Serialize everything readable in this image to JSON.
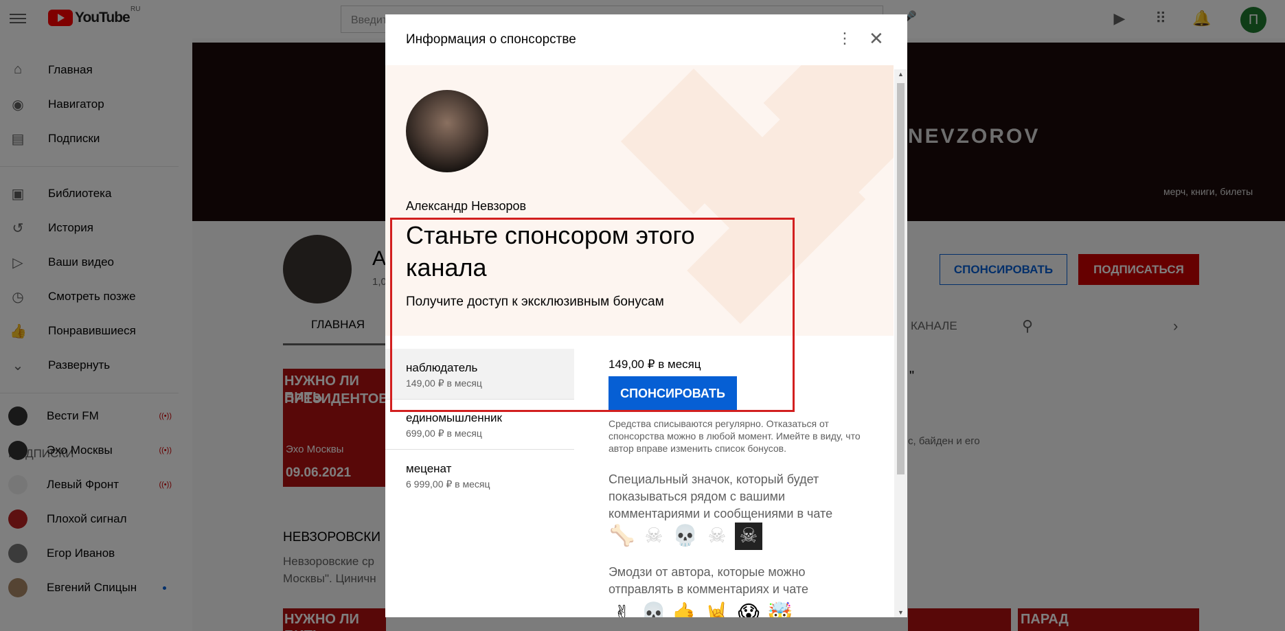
{
  "topbar": {
    "logo_text": "YouTube",
    "region": "RU",
    "search_placeholder": "Введите запрос",
    "avatar_letter": "П"
  },
  "sidebar": {
    "items": [
      {
        "label": "Главная",
        "icon": "home-icon"
      },
      {
        "label": "Навигатор",
        "icon": "compass-icon"
      },
      {
        "label": "Подписки",
        "icon": "subscriptions-icon"
      },
      {
        "label": "Библиотека",
        "icon": "library-icon"
      },
      {
        "label": "История",
        "icon": "history-icon"
      },
      {
        "label": "Ваши видео",
        "icon": "your-videos-icon"
      },
      {
        "label": "Смотреть позже",
        "icon": "clock-icon"
      },
      {
        "label": "Понравившиеся",
        "icon": "thumbs-up-icon"
      },
      {
        "label": "Развернуть",
        "icon": "chevron-down-icon"
      }
    ],
    "subs_heading": "ПОДПИСКИ",
    "subs": [
      {
        "label": "Вести FM",
        "live": "((•))"
      },
      {
        "label": "Эхо Москвы",
        "live": "((•))"
      },
      {
        "label": "Левый Фронт",
        "live": "((•))"
      },
      {
        "label": "Плохой сигнал"
      },
      {
        "label": "Егор Иванов"
      },
      {
        "label": "Евгений Спицын",
        "dot": true
      }
    ]
  },
  "channel": {
    "banner_text": "NEVZOROV",
    "banner_merch": "мерч, книги, билеты",
    "name_fragment": "А",
    "subs_fragment": "1,0",
    "sponsor_button": "СПОНСИРОВАТЬ",
    "subscribe_button": "ПОДПИСАТЬСЯ",
    "tab_main": "ГЛАВНАЯ",
    "tab_about": "О КАНАЛЕ",
    "section_title": "НЕВЗОРОВСКИ",
    "section_desc_1": "Невзоровские ср",
    "section_desc_2": "Москвы\". Циничн",
    "thumb1_line1": "НУЖНО ЛИ БИТЬ",
    "thumb1_line2": "ПРЕЗИДЕНТОВ?",
    "thumb1_date": "09.06.2021",
    "thumb1_caption": "Эхо Москвы",
    "side_text_1": "\"",
    "side_text_2": "с, байден и его",
    "row2_thumb1": "НУЖНО ЛИ  БИТЬ",
    "row2_thumb4": "ПАРАД"
  },
  "dialog": {
    "title": "Информация о спонсорстве",
    "author": "Александр Невзоров",
    "headline": "Станьте спонсором этого канала",
    "subheadline": "Получите доступ к эксклюзивным бонусам",
    "tiers": [
      {
        "name": "наблюдатель",
        "price": "149,00 ₽ в месяц",
        "active": true
      },
      {
        "name": "единомышленник",
        "price": "699,00 ₽ в месяц"
      },
      {
        "name": "меценат",
        "price": "6 999,00 ₽ в месяц"
      }
    ],
    "detail_price": "149,00 ₽ в месяц",
    "detail_button": "СПОНСИРОВАТЬ",
    "note": "Средства списываются регулярно. Отказаться от спонсорства можно в любой момент. Имейте в виду, что автор вправе изменить список бонусов.",
    "badge_desc": "Специальный значок, который будет показываться рядом с вашими комментариями и сообщениями в чате",
    "badges": [
      "🦴",
      "☠",
      "💀",
      "☠",
      "☠"
    ],
    "emoji_desc": "Эмодзи от автора, которые можно отправлять в комментариях и чате",
    "emojis": [
      "✌",
      "💀",
      "🤙",
      "🤘",
      "😱",
      "🤯"
    ]
  },
  "colors": {
    "accent_blue": "#065fd4",
    "subscribe_red": "#cc0000",
    "highlight_red": "#d21f1f",
    "hero_bg": "#fdf5f0"
  }
}
